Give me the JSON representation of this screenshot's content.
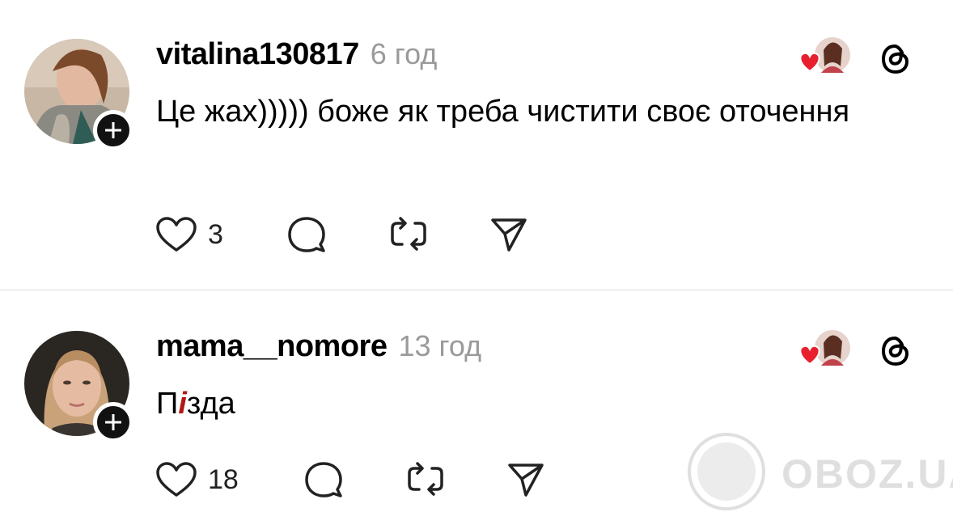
{
  "posts": [
    {
      "username": "vitalina130817",
      "timestamp": "6 год",
      "text": "Це жах))))) боже як треба чистити своє оточення",
      "likes": "3",
      "icons": {
        "like": "heart-outline-icon",
        "reply": "speech-bubble-icon",
        "repost": "repost-icon",
        "share": "send-icon",
        "app": "threads-icon",
        "follow": "plus-icon"
      }
    },
    {
      "username": "mama__nomore",
      "timestamp": "13 год",
      "text_parts": [
        "П",
        "і",
        "зда"
      ],
      "likes": "18",
      "icons": {
        "like": "heart-outline-icon",
        "reply": "speech-bubble-icon",
        "repost": "repost-icon",
        "share": "send-icon",
        "app": "threads-icon",
        "follow": "plus-icon"
      }
    }
  ],
  "watermark": {
    "text": "OBOZ.UA"
  },
  "colors": {
    "heart": "#e8202e",
    "badge": "#111111",
    "muted": "#9a9a9a",
    "divider": "#dcdcdc",
    "censor_mark": "#b01818"
  }
}
